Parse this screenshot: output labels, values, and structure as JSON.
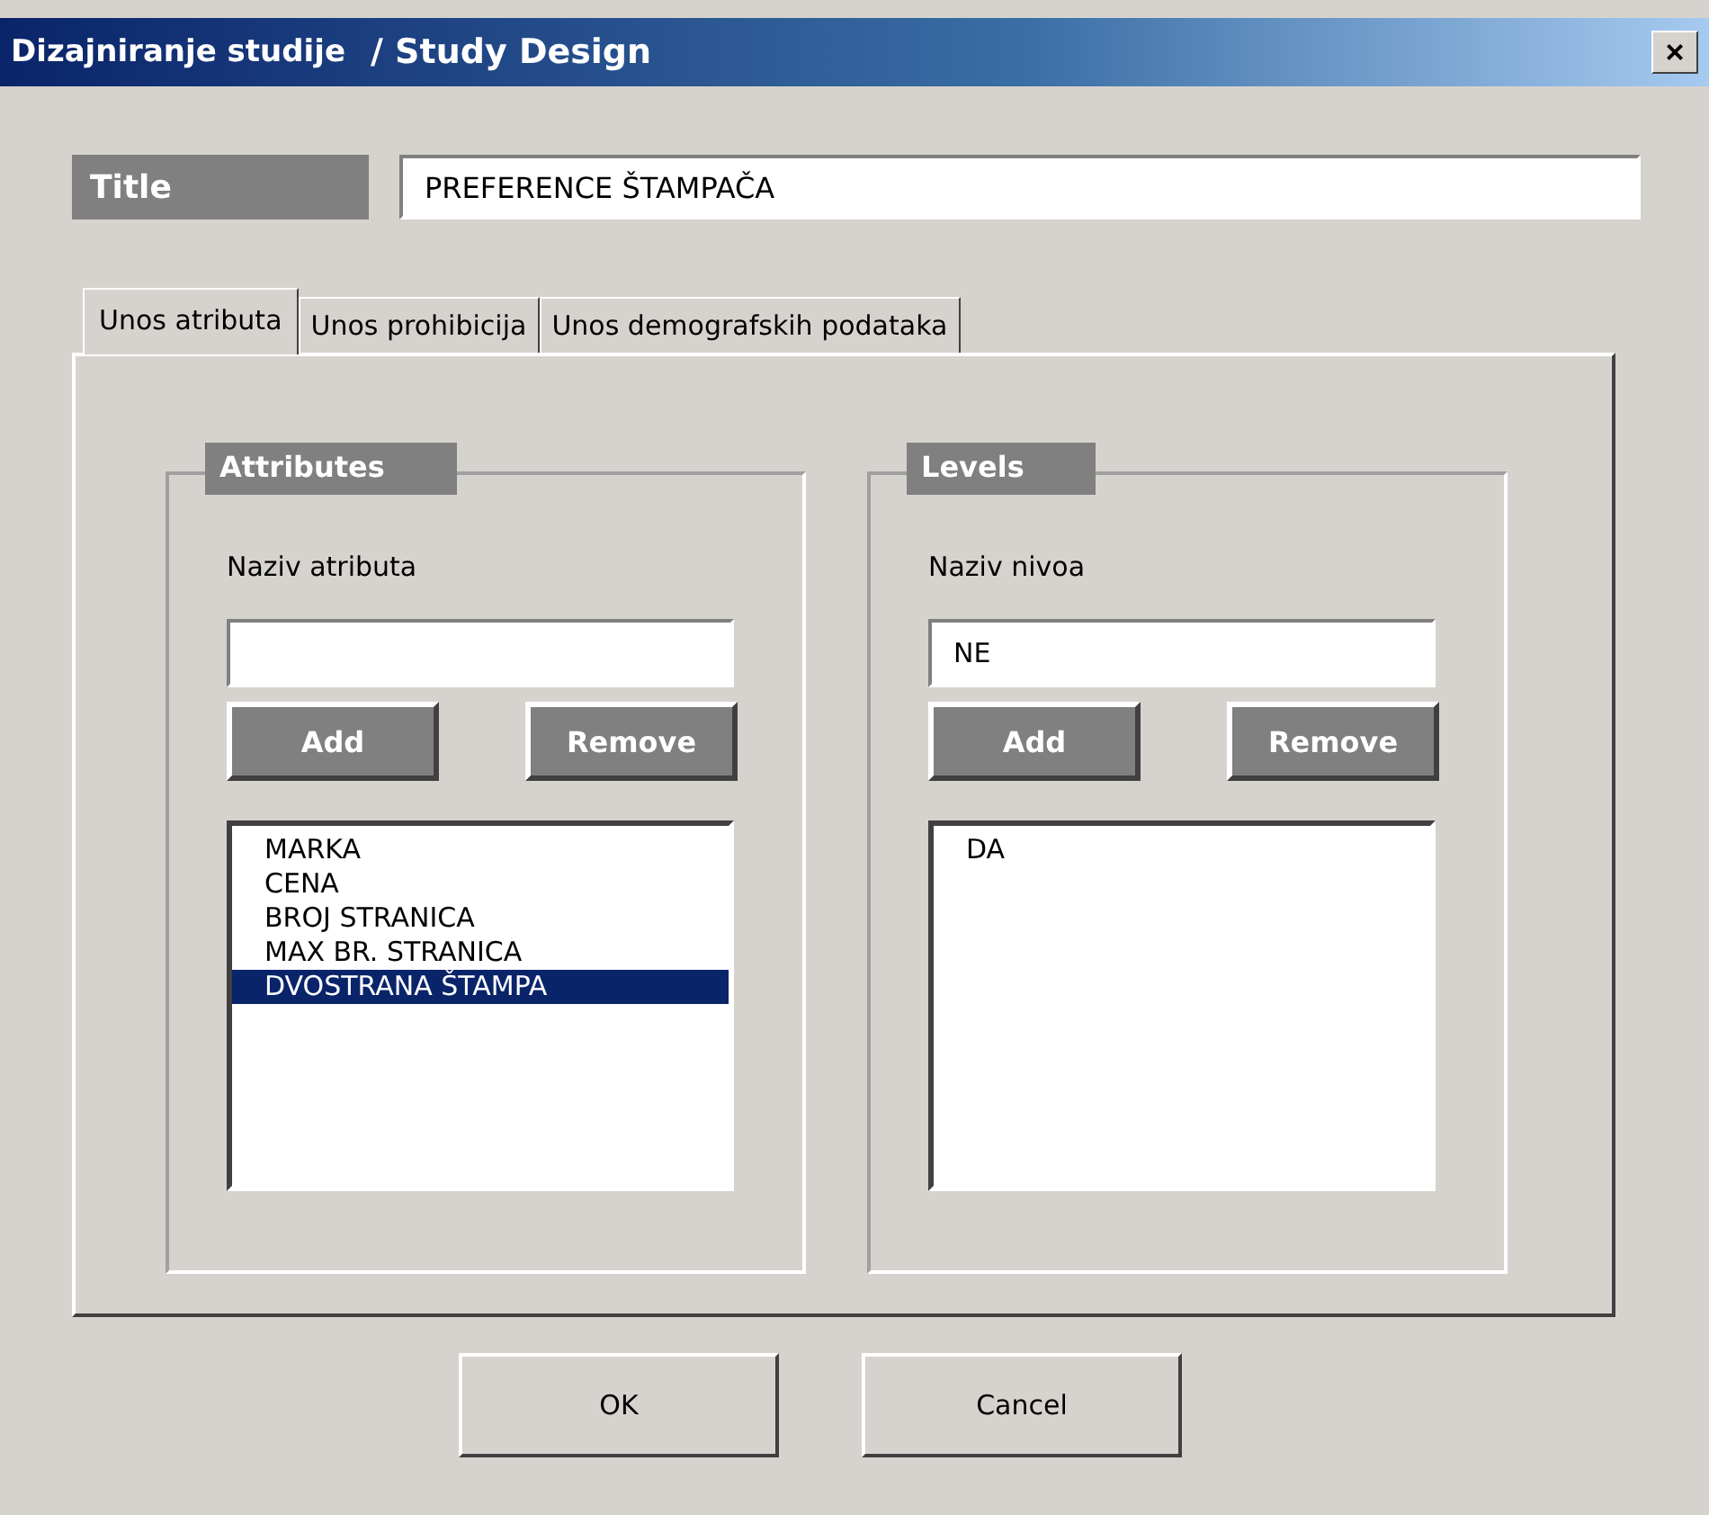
{
  "window": {
    "title": "Dizajniranje studije",
    "subtitle": "/ Study Design",
    "close": "×"
  },
  "title_field": {
    "label": "Title",
    "value": "PREFERENCE ŠTAMPAČA"
  },
  "tabs": [
    {
      "label": "Unos atributa",
      "selected": true
    },
    {
      "label": "Unos prohibicija",
      "selected": false
    },
    {
      "label": "Unos demografskih podataka",
      "selected": false
    }
  ],
  "groups": [
    {
      "legend": "Attributes",
      "field_label": "Naziv atributa",
      "add": "Add",
      "remove": "Remove",
      "items": [
        {
          "label": "MARKA",
          "selected": false
        },
        {
          "label": "CENA",
          "selected": false
        },
        {
          "label": "BROJ STRANICA",
          "selected": false
        },
        {
          "label": "MAX BR. STRANICA",
          "selected": false
        },
        {
          "label": "DVOSTRANA ŠTAMPA",
          "selected": true
        }
      ]
    },
    {
      "legend": "Levels",
      "field_label": "Naziv nivoa",
      "value": "NE",
      "add": "Add",
      "remove": "Remove",
      "items": [
        {
          "label": "DA",
          "selected": false
        }
      ]
    }
  ],
  "buttons": [
    "OK",
    "Cancel"
  ]
}
